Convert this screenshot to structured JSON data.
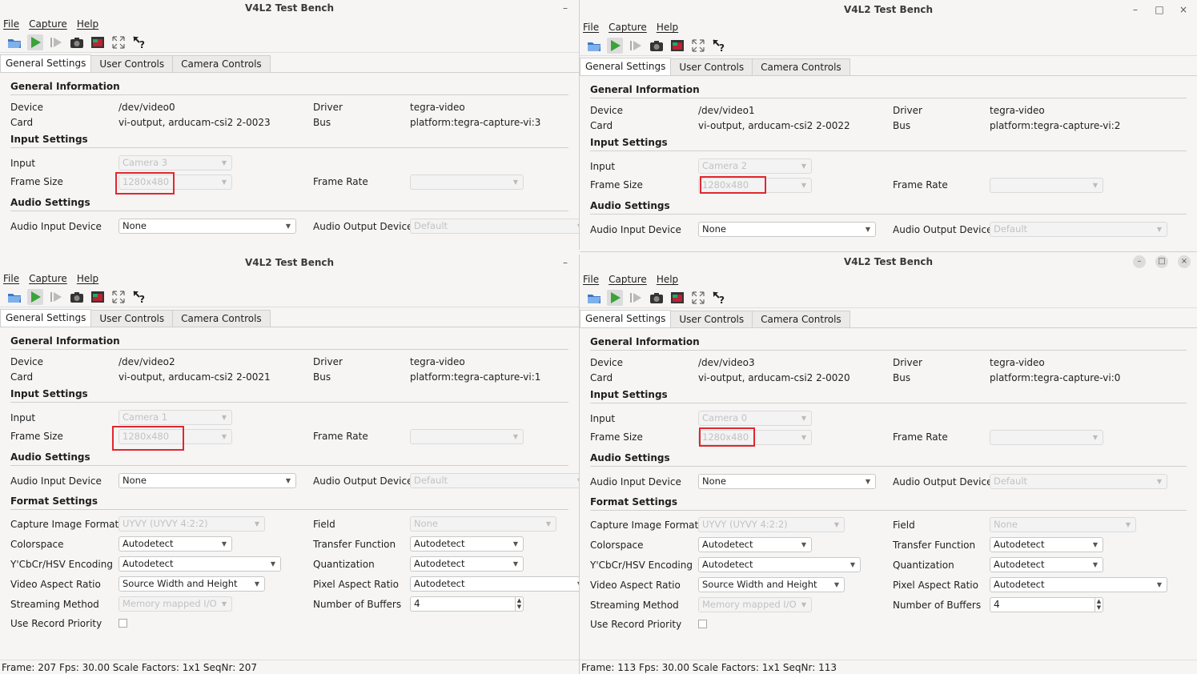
{
  "app_title": "V4L2 Test Bench",
  "menu": {
    "file": "File",
    "capture": "Capture",
    "help": "Help"
  },
  "tabs": {
    "general": "General Settings",
    "user": "User Controls",
    "camera": "Camera Controls"
  },
  "labels": {
    "general_info": "General Information",
    "device": "Device",
    "card": "Card",
    "driver": "Driver",
    "bus": "Bus",
    "input_settings": "Input Settings",
    "input": "Input",
    "frame_size": "Frame Size",
    "frame_rate": "Frame Rate",
    "audio_settings": "Audio Settings",
    "audio_in": "Audio Input Device",
    "audio_out": "Audio Output Device",
    "format_settings": "Format Settings",
    "capture_formats": "Capture Image Formats",
    "field": "Field",
    "colorspace": "Colorspace",
    "transfer": "Transfer Function",
    "ycbcr": "Y'CbCr/HSV Encoding",
    "quantization": "Quantization",
    "video_aspect": "Video Aspect Ratio",
    "pixel_aspect": "Pixel Aspect Ratio",
    "streaming": "Streaming Method",
    "buffers": "Number of Buffers",
    "record_priority": "Use Record Priority"
  },
  "values": {
    "driver": "tegra-video",
    "frame_size": "1280x480",
    "audio_in": "None",
    "audio_out": "Default",
    "capture_format": "UYVY (UYVY 4:2:2)",
    "field": "None",
    "autodetect": "Autodetect",
    "video_aspect": "Source Width and Height",
    "streaming": "Memory mapped I/O",
    "buffers": "4"
  },
  "windows": {
    "tl": {
      "device": "/dev/video0",
      "card": "vi-output, arducam-csi2 2-0023",
      "bus": "platform:tegra-capture-vi:3",
      "input": "Camera 3"
    },
    "tr": {
      "device": "/dev/video1",
      "card": "vi-output, arducam-csi2 2-0022",
      "bus": "platform:tegra-capture-vi:2",
      "input": "Camera 2"
    },
    "bl": {
      "device": "/dev/video2",
      "card": "vi-output, arducam-csi2 2-0021",
      "bus": "platform:tegra-capture-vi:1",
      "input": "Camera 1",
      "status": "Frame: 207 Fps: 30.00 Scale Factors: 1x1 SeqNr: 207"
    },
    "br": {
      "device": "/dev/video3",
      "card": "vi-output, arducam-csi2 2-0020",
      "bus": "platform:tegra-capture-vi:0",
      "input": "Camera 0",
      "status": "Frame: 113 Fps: 30.00 Scale Factors: 1x1 SeqNr: 113"
    }
  },
  "icons": [
    "open-icon",
    "play-icon",
    "step-icon",
    "snapshot-icon",
    "video-window-icon",
    "fullscreen-icon",
    "whats-this-icon"
  ],
  "colors": {
    "highlight": "#e0282e",
    "play": "#3aa33a",
    "open": "#3a78c8"
  }
}
